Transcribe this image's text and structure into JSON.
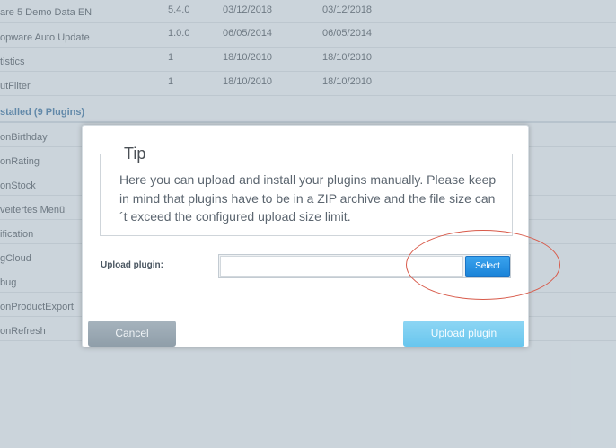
{
  "plugins_top": [
    {
      "name": "are 5 Demo Data EN",
      "version": "5.4.0",
      "date1": "03/12/2018",
      "date2": "03/12/2018"
    },
    {
      "name": "opware Auto Update",
      "version": "1.0.0",
      "date1": "06/05/2014",
      "date2": "06/05/2014"
    },
    {
      "name": "tistics",
      "version": "1",
      "date1": "18/10/2010",
      "date2": "18/10/2010"
    },
    {
      "name": "utFilter",
      "version": "1",
      "date1": "18/10/2010",
      "date2": "18/10/2010"
    }
  ],
  "installed_header": "stalled (9 Plugins)",
  "plugins_installed": [
    "onBirthday",
    "onRating",
    "onStock",
    "veitertes Menü",
    "ification",
    "gCloud",
    "bug",
    "onProductExport",
    "onRefresh"
  ],
  "dialog": {
    "tip_title": "Tip",
    "tip_text": "Here you can upload and install your plugins manually. Please keep in mind that plugins have to be in a ZIP archive and the file size can´t exceed the configured upload size limit.",
    "upload_label": "Upload plugin:",
    "file_value": "",
    "select_label": "Select",
    "cancel_label": "Cancel",
    "upload_button_label": "Upload plugin"
  },
  "colors": {
    "select_button": "#1b84d9",
    "upload_button": "#68c6ee",
    "cancel_button": "#8f9ea9",
    "annotation_circle": "#d85a4a"
  }
}
